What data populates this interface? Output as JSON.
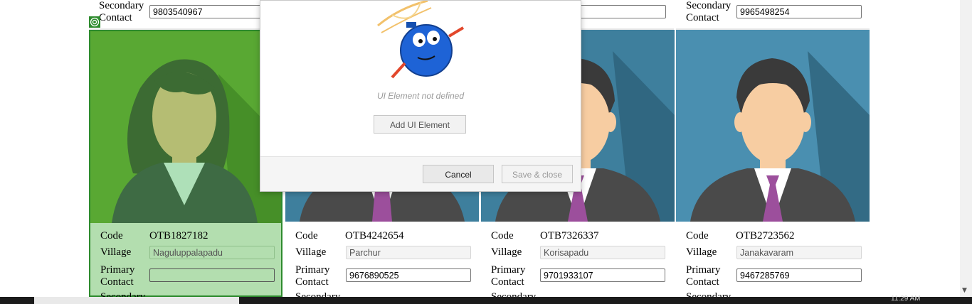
{
  "labels": {
    "code": "Code",
    "village": "Village",
    "primary": [
      "Primary",
      "Contact"
    ],
    "secondary": [
      "Secondary",
      "Contact"
    ],
    "secondary_partial": "Secondary"
  },
  "top_cards": [
    {
      "secondary_contact": "9803540967"
    },
    {
      "secondary_contact": ""
    },
    {
      "secondary_contact": ""
    },
    {
      "secondary_contact": "9965498254"
    }
  ],
  "cards": [
    {
      "code": "OTB1827182",
      "village": "Naguluppalapadu",
      "primary_contact": "",
      "gender": "female",
      "selected": true
    },
    {
      "code": "OTB4242654",
      "village": "Parchur",
      "primary_contact": "9676890525",
      "gender": "male"
    },
    {
      "code": "OTB7326337",
      "village": "Korisapadu",
      "primary_contact": "9701933107",
      "gender": "male"
    },
    {
      "code": "OTB2723562",
      "village": "Janakavaram",
      "primary_contact": "9467285769",
      "gender": "male"
    }
  ],
  "dialog": {
    "empty_message": "UI Element not defined",
    "add_button": "Add UI Element",
    "cancel_button": "Cancel",
    "save_button": "Save & close"
  },
  "taskbar": {
    "clock": "11:29 AM"
  },
  "colors": {
    "selected_bg": "#b3deaf",
    "selected_border": "#2e8b2e",
    "photo_female_bg": "#4c9a2a",
    "photo_male_bg": "#3e7f9d"
  }
}
